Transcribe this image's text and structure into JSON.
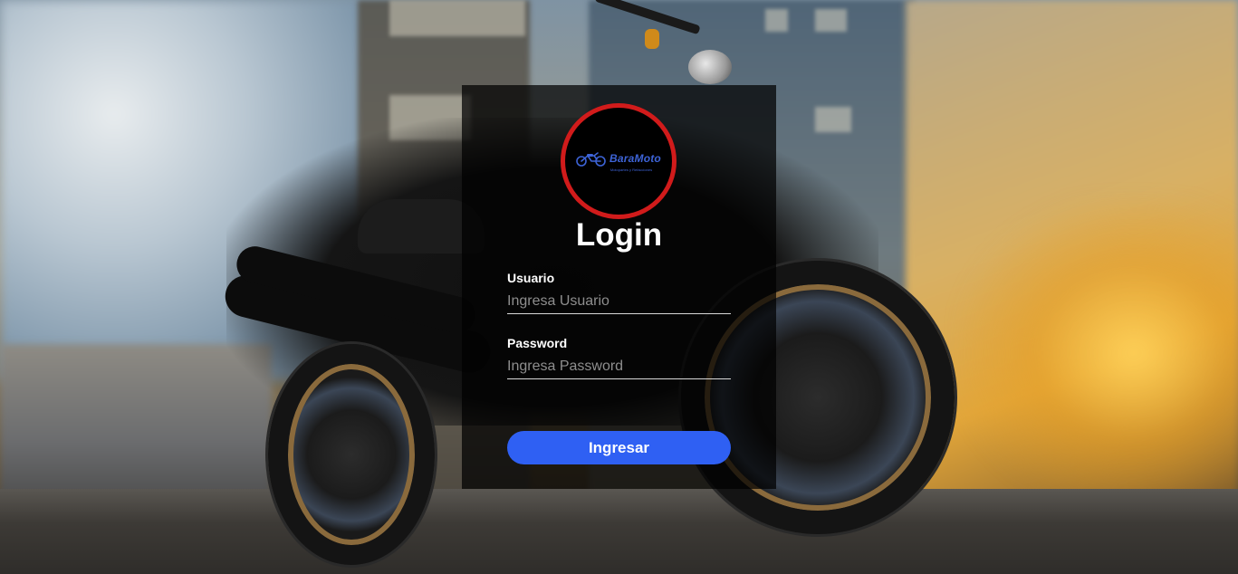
{
  "brand": {
    "name": "BaraMoto",
    "tagline": "Motopartes y Refacciones"
  },
  "login": {
    "title": "Login",
    "username": {
      "label": "Usuario",
      "placeholder": "Ingresa Usuario",
      "value": ""
    },
    "password": {
      "label": "Password",
      "placeholder": "Ingresa Password",
      "value": ""
    },
    "submit_label": "Ingresar"
  },
  "colors": {
    "accent": "#2f60f3",
    "logo_ring": "#d11b1b",
    "logo_text": "#3d63d6",
    "panel": "rgba(0,0,0,0.72)"
  },
  "icons": {
    "logo": "motorcycle-icon"
  }
}
